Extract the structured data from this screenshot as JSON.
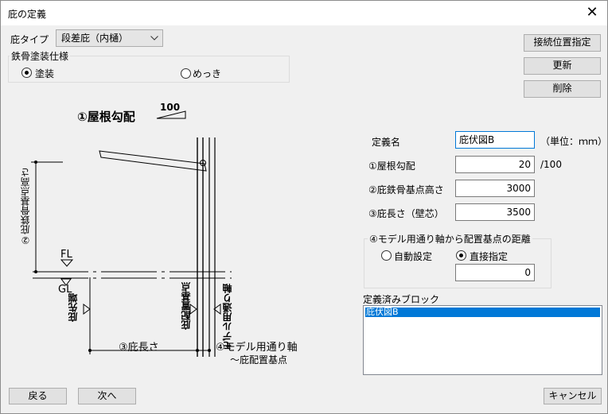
{
  "window": {
    "title": "庇の定義"
  },
  "eave_type": {
    "label": "庇タイプ",
    "value": "段差庇（内樋）"
  },
  "coating": {
    "legend": "鉄骨塗装仕様",
    "options": [
      {
        "label": "塗装",
        "selected": true
      },
      {
        "label": "めっき",
        "selected": false
      }
    ]
  },
  "buttons": {
    "connect_position": "接続位置指定",
    "update": "更新",
    "delete": "削除",
    "back": "戻る",
    "next": "次へ",
    "cancel": "キャンセル"
  },
  "form": {
    "name_label": "定義名",
    "name_value": "庇伏図B",
    "unit_label": "（単位：ｍｍ）",
    "roof_slope_label": "①屋根勾配",
    "roof_slope_value": "20",
    "roof_slope_unit": "/100",
    "base_height_label": "②庇鉄骨基点高さ",
    "base_height_value": "3000",
    "eave_length_label": "③庇長さ（壁芯）",
    "eave_length_value": "3500"
  },
  "distance": {
    "legend": "④モデル用通り軸から配置基点の距離",
    "options": [
      {
        "label": "自動設定",
        "selected": false
      },
      {
        "label": "直接指定",
        "selected": true
      }
    ],
    "value": "0"
  },
  "defined_blocks": {
    "label": "定義済みブロック",
    "items": [
      "庇伏図B"
    ]
  },
  "diagram": {
    "roof_slope": "①屋根勾配",
    "slope_value": "100",
    "base_height": "②庇鉄骨基点高さ",
    "fl": "FL",
    "gl": "GL",
    "eave_tip": "庇先端",
    "eave_base": "庇配置基点",
    "model_axis": "モデル用通り軸",
    "eave_length": "③庇長さ",
    "distance_line1": "④モデル用通り軸",
    "distance_line2": "～庇配置基点"
  }
}
